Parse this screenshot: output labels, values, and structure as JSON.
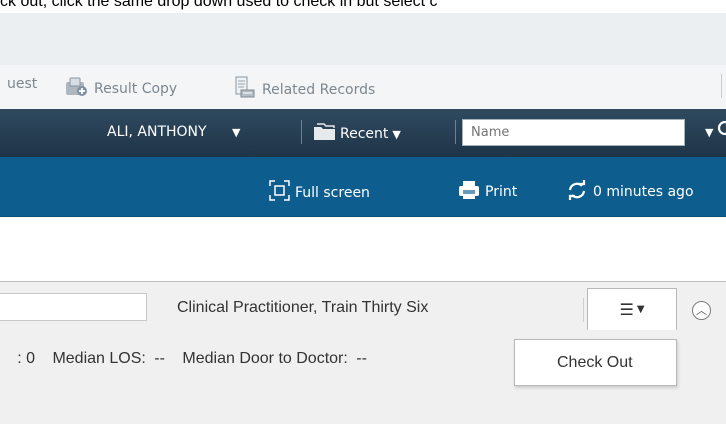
{
  "instruction_text": "ck out, click the same drop down used to check in but select c",
  "toolbar": {
    "items": [
      {
        "label": "uest",
        "icon": ""
      },
      {
        "label": "Result Copy",
        "icon": "result-copy-icon"
      },
      {
        "label": "Related Records",
        "icon": "related-records-icon"
      }
    ]
  },
  "navbar": {
    "patient_name": "ALI, ANTHONY",
    "recent_label": "Recent",
    "name_placeholder": "Name",
    "search_icon": "search-icon"
  },
  "bluebar": {
    "full_screen_label": "Full screen",
    "print_label": "Print",
    "refresh_label": "0 minutes ago"
  },
  "lower": {
    "clinician_name": "Clinical Practitioner, Train Thirty Six",
    "menu_icon": "☰",
    "dropdown_item": "Check Out",
    "stats": {
      "prefix": ": 0",
      "median_los_label": "Median LOS:",
      "median_los_value": "--",
      "door_to_doctor_label": "Median Door to Doctor:",
      "door_to_doctor_value": "--"
    }
  },
  "colors": {
    "navbar": "#2f4a60",
    "bluebar": "#0d5e8f",
    "toolbar": "#f4f5f6",
    "lower_bg": "#f0f0f0"
  }
}
